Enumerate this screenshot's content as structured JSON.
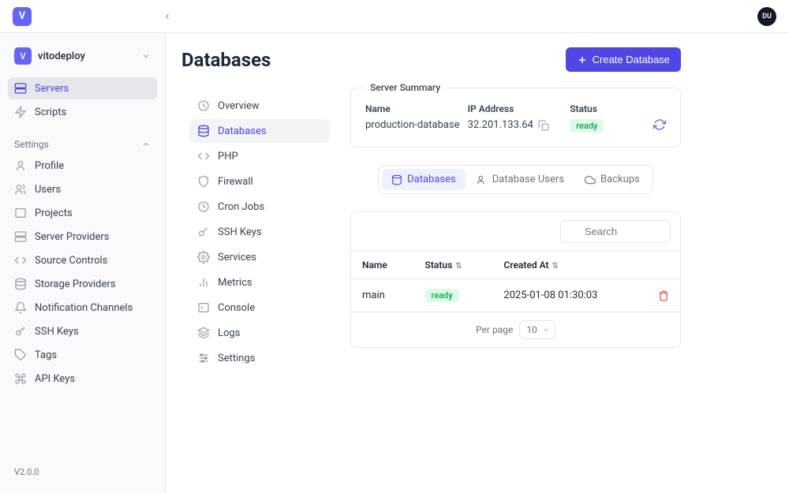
{
  "header": {
    "logo_letter": "V",
    "avatar_initials": "DU"
  },
  "sidebar": {
    "project": {
      "icon_letter": "V",
      "name": "vitodeploy"
    },
    "items": [
      {
        "label": "Servers",
        "icon": "server",
        "active": true
      },
      {
        "label": "Scripts",
        "icon": "zap"
      }
    ],
    "settings_label": "Settings",
    "settings_items": [
      {
        "label": "Profile",
        "icon": "user"
      },
      {
        "label": "Users",
        "icon": "users"
      },
      {
        "label": "Projects",
        "icon": "box"
      },
      {
        "label": "Server Providers",
        "icon": "server"
      },
      {
        "label": "Source Controls",
        "icon": "code"
      },
      {
        "label": "Storage Providers",
        "icon": "database"
      },
      {
        "label": "Notification Channels",
        "icon": "bell"
      },
      {
        "label": "SSH Keys",
        "icon": "key"
      },
      {
        "label": "Tags",
        "icon": "tag"
      },
      {
        "label": "API Keys",
        "icon": "cmd"
      }
    ],
    "version": "V2.0.0"
  },
  "subnav": {
    "items": [
      {
        "label": "Overview",
        "icon": "gauge"
      },
      {
        "label": "Databases",
        "icon": "database",
        "active": true
      },
      {
        "label": "PHP",
        "icon": "code"
      },
      {
        "label": "Firewall",
        "icon": "shield"
      },
      {
        "label": "Cron Jobs",
        "icon": "clock"
      },
      {
        "label": "SSH Keys",
        "icon": "key"
      },
      {
        "label": "Services",
        "icon": "cog"
      },
      {
        "label": "Metrics",
        "icon": "chart"
      },
      {
        "label": "Console",
        "icon": "terminal"
      },
      {
        "label": "Logs",
        "icon": "layers"
      },
      {
        "label": "Settings",
        "icon": "sliders"
      }
    ]
  },
  "page": {
    "title": "Databases",
    "create_button": "Create Database"
  },
  "summary": {
    "legend": "Server Summary",
    "name_label": "Name",
    "name_value": "production-database",
    "ip_label": "IP Address",
    "ip_value": "32.201.133.64",
    "status_label": "Status",
    "status_value": "ready"
  },
  "tabs": [
    {
      "label": "Databases",
      "icon": "database",
      "active": true
    },
    {
      "label": "Database Users",
      "icon": "users"
    },
    {
      "label": "Backups",
      "icon": "cloud"
    }
  ],
  "table": {
    "search_placeholder": "Search",
    "columns": {
      "name": "Name",
      "status": "Status",
      "created": "Created At"
    },
    "rows": [
      {
        "name": "main",
        "status": "ready",
        "created": "2025-01-08 01:30:03"
      }
    ],
    "per_page_label": "Per page",
    "per_page_value": "10"
  }
}
